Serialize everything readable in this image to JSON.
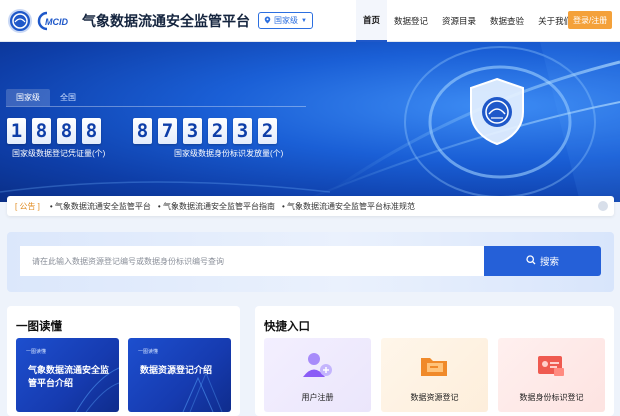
{
  "header": {
    "title": "气象数据流通安全监管平台",
    "region": "国家级",
    "nav": [
      "首页",
      "数据登记",
      "资源目录",
      "数据查验",
      "关于我们"
    ],
    "login": "登录/注册"
  },
  "hero": {
    "tabs": [
      "国家级",
      "全国"
    ],
    "stat1": {
      "digits": [
        "1",
        "8",
        "8",
        "8"
      ],
      "label": "国家级数据登记凭证量(个)"
    },
    "stat2": {
      "digits": [
        "8",
        "7",
        "3",
        "2",
        "3",
        "2"
      ],
      "label": "国家级数据身份标识发放量(个)"
    }
  },
  "notice": {
    "tag": "[ 公告 ]",
    "items": [
      "• 气象数据流通安全监管平台",
      "• 气象数据流通安全监管平台指南",
      "• 气象数据流通安全监管平台标准规范"
    ]
  },
  "search": {
    "placeholder": "请在此输入数据资源登记编号或数据身份标识编号查询",
    "button": "搜索"
  },
  "guide": {
    "title": "一图读懂",
    "tiles": [
      {
        "mini": "一图读懂",
        "text": "气象数据流通安全监管平台介绍"
      },
      {
        "mini": "一图读懂",
        "text": "数据资源登记介绍"
      }
    ]
  },
  "quick": {
    "title": "快捷入口",
    "items": [
      {
        "label": "用户注册",
        "icon": "user-add-icon",
        "color": "#8b5cf6"
      },
      {
        "label": "数据资源登记",
        "icon": "folder-icon",
        "color": "#f08a2a"
      },
      {
        "label": "数据身份标识登记",
        "icon": "id-card-icon",
        "color": "#ef5a50"
      }
    ]
  },
  "colors": {
    "primary": "#1f58c9",
    "accent": "#f4a13a"
  }
}
